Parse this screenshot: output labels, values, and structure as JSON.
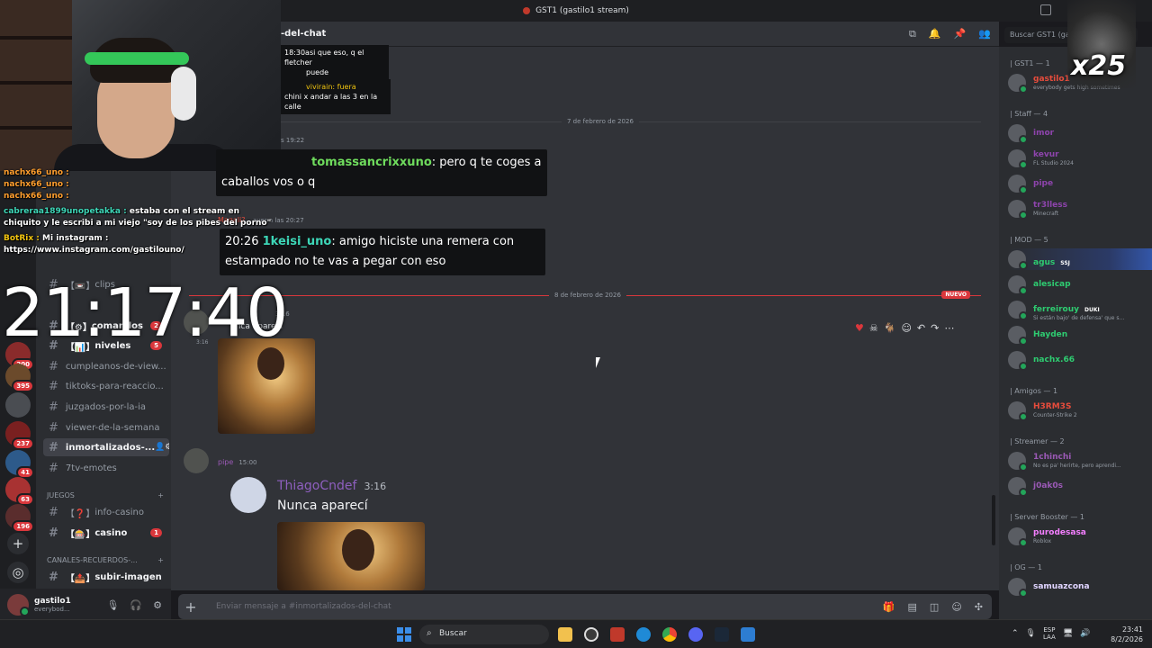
{
  "window": {
    "title": "GST1 (gastilo1 stream)"
  },
  "header": {
    "channel_title": "-del-chat",
    "search_placeholder": "Buscar GST1 (gas"
  },
  "channels": {
    "items": [
      {
        "label": "clips",
        "prefix": "【📼】"
      },
      {
        "label": "comandos",
        "prefix": "【⚙】",
        "badge": "2"
      },
      {
        "label": "niveles",
        "prefix": "【📊】",
        "badge": "5"
      },
      {
        "label": "cumpleanos-de-view..."
      },
      {
        "label": "tiktoks-para-reaccio..."
      },
      {
        "label": "juzgados-por-la-ia"
      },
      {
        "label": "viewer-de-la-semana"
      },
      {
        "label": "inmortalizados-..."
      },
      {
        "label": "7tv-emotes"
      },
      {
        "label": "info-casino",
        "prefix": "【❓】"
      },
      {
        "label": "casino",
        "prefix": "【🎰】",
        "badge": "1"
      },
      {
        "label": "subir-imagen",
        "prefix": "【📤】"
      }
    ],
    "categories": {
      "juegos": "JUEGOS",
      "recuerdos": "CANALES-RECUERDOS-..."
    }
  },
  "servers": {
    "badges": [
      "200",
      "395",
      "237",
      "41",
      "63",
      "196"
    ]
  },
  "user": {
    "name": "gastilo1",
    "status": "everybod..."
  },
  "chat": {
    "date1": "7 de febrero de 2026",
    "date2": "8 de febrero de 2026",
    "new_label": "NUEVO",
    "small_msgs": [
      "18:30asi que eso, q el fletcher",
      "puede",
      "vivirain: fuera",
      "chini x andar a las 3 en la calle"
    ],
    "msg1_time": "s 19:22",
    "bubble1_user": "tomassancrixxuno",
    "bubble1_text": ": pero q te coges a",
    "bubble1_text2": "caballos vos o q",
    "msg2_name": "Magali?",
    "msg2_time": "ayer a las 20:27",
    "bubble2_time": "20:26",
    "bubble2_user": "1keisi_uno",
    "bubble2_text": ": amigo hiciste una remera con",
    "bubble2_text2": "estampado no te vas a pegar con eso",
    "msg3_time": "3:16",
    "msg3_text": "unca aparecí",
    "msg3_side_time": "3:16",
    "msg4_name": "pipe",
    "msg4_time": "15:00",
    "quote_name": "ThiagoCndef",
    "quote_time": "3:16",
    "quote_text": "Nunca aparecí",
    "composer_placeholder": "Enviar mensaje a #inmortalizados-del-chat"
  },
  "members": {
    "groups": [
      {
        "label": "| GST1 — 1",
        "members": [
          {
            "name": "gastilo1",
            "activity": "everybody gets high sometimes",
            "color": "#e74c3c"
          }
        ]
      },
      {
        "label": "| Staff — 4",
        "members": [
          {
            "name": "imor",
            "activity": "",
            "color": "#8e44ad"
          },
          {
            "name": "kevur",
            "activity": "FL Studio 2024",
            "color": "#8e44ad"
          },
          {
            "name": "pipe",
            "activity": "",
            "color": "#8e44ad"
          },
          {
            "name": "tr3lless",
            "activity": "Minecraft",
            "color": "#8e44ad"
          }
        ]
      },
      {
        "label": "| MOD — 5",
        "members": [
          {
            "name": "agus",
            "activity": "",
            "color": "#2ecc71",
            "tag": "SSJ"
          },
          {
            "name": "alesicap",
            "activity": "",
            "color": "#2ecc71"
          },
          {
            "name": "ferreirouy",
            "activity": "Si están bajo' de defensa' que s...",
            "color": "#2ecc71",
            "tag": "DUKI"
          },
          {
            "name": "Hayden",
            "activity": "",
            "color": "#2ecc71"
          },
          {
            "name": "nachx.66",
            "activity": "",
            "color": "#2ecc71"
          }
        ]
      },
      {
        "label": "| Amigos — 1",
        "members": [
          {
            "name": "H3RM3S",
            "activity": "Counter-Strike 2",
            "color": "#e74c3c"
          }
        ]
      },
      {
        "label": "| Streamer — 2",
        "members": [
          {
            "name": "1chinchi",
            "activity": "No es pa' herirte, pero aprendi...",
            "color": "#9b59b6"
          },
          {
            "name": "j0ak0s",
            "activity": "",
            "color": "#9b59b6"
          }
        ]
      },
      {
        "label": "| Server Booster — 1",
        "members": [
          {
            "name": "purodesasa",
            "activity": "Roblox",
            "color": "#f47fff"
          }
        ]
      },
      {
        "label": "| OG — 1",
        "members": [
          {
            "name": "samuazcona",
            "activity": "",
            "color": "#e0d4ff"
          }
        ]
      }
    ]
  },
  "overlay": {
    "badge": "x25",
    "clock": "21:17:40",
    "twitch_lines": [
      {
        "user": "nachx66_uno :",
        "text": "",
        "color": "#ff9f2e"
      },
      {
        "user": "nachx66_uno :",
        "text": "",
        "color": "#ff9f2e"
      },
      {
        "user": "nachx66_uno :",
        "text": "",
        "color": "#ff9f2e"
      },
      {
        "user": "cabreraa1899unopetakka :",
        "text": " estaba con el stream en",
        "color": "#3dd6b7"
      },
      {
        "user": "",
        "text": "chiquito y le escribi a mi viejo \"soy de los pibes del porno\"",
        "color": "#ffffff"
      },
      {
        "user": "BotRix :",
        "text": " Mi instagram :",
        "color": "#f1c40f"
      },
      {
        "user": "",
        "text": "https://www.instagram.com/gastilouno/",
        "color": "#ffffff"
      }
    ]
  },
  "taskbar": {
    "search": "Buscar",
    "lang1": "ESP",
    "lang2": "LAA",
    "time": "23:41",
    "date": "8/2/2026"
  }
}
